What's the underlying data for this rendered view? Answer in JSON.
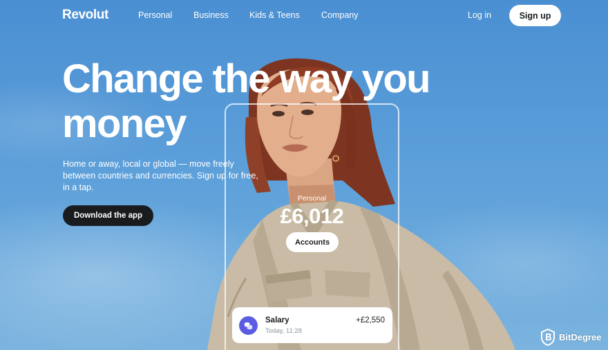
{
  "nav": {
    "logo": "Revolut",
    "links": [
      "Personal",
      "Business",
      "Kids & Teens",
      "Company"
    ],
    "login": "Log in",
    "signup": "Sign up"
  },
  "hero": {
    "title_line1": "Change the way you",
    "title_line2": "money",
    "subtitle": "Home or away, local or global — move freely between countries and currencies. Sign up for free, in a tap.",
    "cta": "Download the app"
  },
  "phone": {
    "account_label": "Personal",
    "balance": "£6,012",
    "accounts_button": "Accounts",
    "transaction": {
      "name": "Salary",
      "time": "Today, 11:28",
      "amount": "+£2,550",
      "icon": "coins-icon"
    }
  },
  "watermark": {
    "text": "BitDegree",
    "icon": "shield-b-icon"
  },
  "colors": {
    "sky": "#5b9ed9",
    "dark_button": "#191c1f",
    "accent_purple": "#5b5ce2",
    "hair": "#8a3a22",
    "jacket": "#c9bba5"
  }
}
